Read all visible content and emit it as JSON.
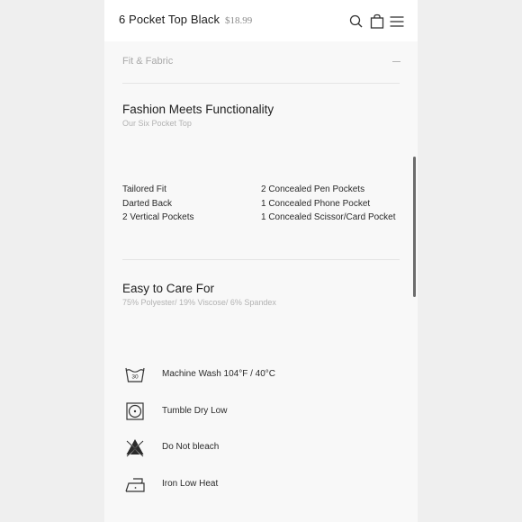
{
  "header": {
    "title": "6 Pocket Top Black",
    "price": "$18.99",
    "icons": [
      "search-icon",
      "bag-icon",
      "menu-icon"
    ]
  },
  "fit_fabric": {
    "title": "Fit & Fabric",
    "toggle_icon": "minus-icon"
  },
  "functionality": {
    "title": "Fashion Meets Functionality",
    "subtitle": "Our Six Pocket Top",
    "features_left": [
      "Tailored Fit",
      "Darted Back",
      "2 Vertical Pockets"
    ],
    "features_right": [
      "2 Concealed Pen Pockets",
      "1 Concealed Phone Pocket",
      "1 Concealed Scissor/Card Pocket"
    ]
  },
  "care": {
    "title": "Easy to Care For",
    "subtitle": "75% Polyester/ 19% Viscose/ 6% Spandex",
    "instructions": [
      {
        "label": "Machine Wash 104°F / 40°C",
        "icon": "wash-30-icon",
        "icon_text": "30"
      },
      {
        "label": "Tumble Dry Low",
        "icon": "tumble-dry-icon"
      },
      {
        "label": "Do Not bleach",
        "icon": "no-bleach-icon"
      },
      {
        "label": "Iron Low Heat",
        "icon": "iron-low-icon"
      }
    ]
  },
  "colors": {
    "page_bg": "#efefef",
    "panel_bg": "#f8f8f8",
    "header_bg": "#ffffff",
    "text": "#222222",
    "muted": "#b2b2b2"
  }
}
